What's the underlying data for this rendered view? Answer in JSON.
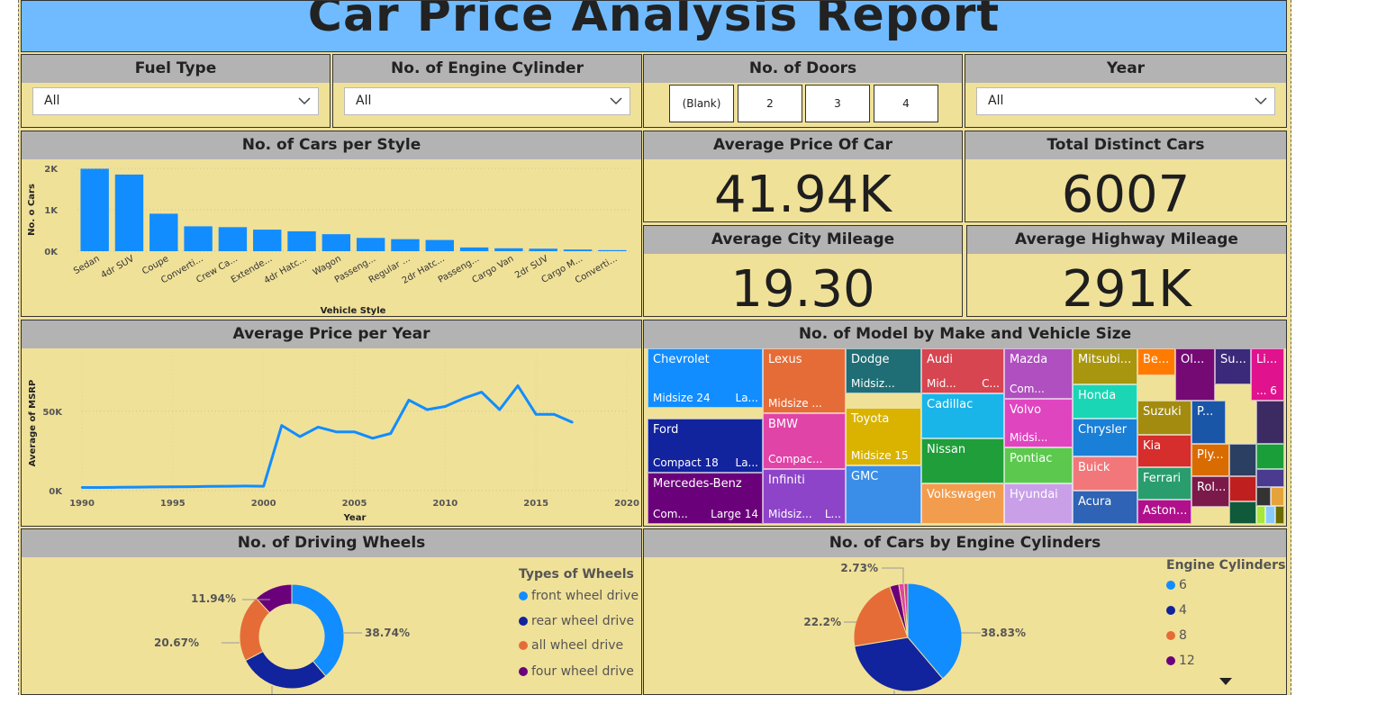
{
  "report_title": "Car Price Analysis Report",
  "filters": {
    "fuel_type": {
      "label": "Fuel Type",
      "value": "All"
    },
    "engine_cylinder": {
      "label": "No. of Engine Cylinder",
      "value": "All"
    },
    "doors": {
      "label": "No. of Doors",
      "options": [
        "(Blank)",
        "2",
        "3",
        "4"
      ]
    },
    "year": {
      "label": "Year",
      "value": "All"
    }
  },
  "kpis": {
    "avg_price": {
      "label": "Average Price Of Car",
      "value": "41.94K"
    },
    "total_cars": {
      "label": "Total Distinct Cars",
      "value": "6007"
    },
    "city_mileage": {
      "label": "Average City Mileage",
      "value": "19.30"
    },
    "highway_mileage": {
      "label": "Average Highway Mileage",
      "value": "291K"
    }
  },
  "colors": {
    "accent": "#118dff",
    "dark_blue": "#12239e",
    "orange": "#e66c37",
    "purple": "#6b007b",
    "panel_bg": "#f0e199",
    "header_bg": "#b3b3b3",
    "title_bg": "#70bbff"
  },
  "charts": {
    "style_chart": {
      "title": "No. of Cars per Style",
      "xlabel": "Vehicle Style",
      "ylabel": "No. o Cars",
      "ytick_labels": [
        "2K",
        "1K",
        "0K"
      ]
    },
    "year_chart": {
      "title": "Average Price per Year",
      "xlabel": "Year",
      "ylabel": "Average of MSRP",
      "ytick_labels": [
        "50K",
        "0K"
      ],
      "xtick_labels": [
        "1990",
        "1995",
        "2000",
        "2005",
        "2010",
        "2015",
        "2020"
      ]
    },
    "treemap": {
      "title": "No. of Model by Make and Vehicle Size"
    },
    "wheels_chart": {
      "title": "No. of Driving Wheels",
      "legend_title": "Types of Wheels"
    },
    "cylinders_chart": {
      "title": "No. of Cars by Engine Cylinders",
      "legend_title": "Engine Cylinders"
    }
  },
  "chart_data": [
    {
      "type": "bar",
      "title": "No. of Cars per Style",
      "xlabel": "Vehicle Style",
      "ylabel": "No. o Cars",
      "categories": [
        "Sedan",
        "4dr SUV",
        "Coupe",
        "Converti...",
        "Crew Ca...",
        "Extende...",
        "4dr Hatc...",
        "Wagon",
        "Passeng...",
        "Regular ...",
        "2dr Hatc...",
        "Passeng...",
        "Cargo Van",
        "2dr SUV",
        "Cargo M...",
        "Converti..."
      ],
      "values": [
        1990,
        1850,
        905,
        600,
        580,
        520,
        480,
        410,
        320,
        290,
        270,
        90,
        70,
        60,
        40,
        25
      ],
      "ylim": [
        0,
        2000
      ],
      "color": "#118dff"
    },
    {
      "type": "line",
      "title": "Average Price per Year",
      "xlabel": "Year",
      "ylabel": "Average of MSRP",
      "x": [
        1990,
        1991,
        1992,
        1993,
        1994,
        1995,
        1996,
        1997,
        1998,
        1999,
        2000,
        2001,
        2002,
        2003,
        2004,
        2005,
        2006,
        2007,
        2008,
        2009,
        2010,
        2011,
        2012,
        2013,
        2014,
        2015,
        2016,
        2017
      ],
      "y": [
        2000,
        2000,
        2100,
        2200,
        2300,
        2400,
        2500,
        2700,
        2800,
        2900,
        2800,
        41000,
        34000,
        40000,
        37000,
        37000,
        33000,
        36000,
        57000,
        51000,
        53000,
        58000,
        62000,
        51000,
        66000,
        48000,
        48000,
        43000
      ],
      "xlim": [
        1990,
        2020
      ],
      "ylim": [
        0,
        85000
      ],
      "color": "#118dff"
    },
    {
      "type": "pie",
      "title": "No. of Driving Wheels",
      "legend_title": "Types of Wheels",
      "donut": true,
      "series": [
        {
          "name": "front wheel drive",
          "value": 38.74,
          "label": "38.74%",
          "color": "#118dff"
        },
        {
          "name": "rear wheel drive",
          "value": 28.65,
          "label": "28.65%",
          "color": "#12239e"
        },
        {
          "name": "all wheel drive",
          "value": 20.67,
          "label": "20.67%",
          "color": "#e66c37"
        },
        {
          "name": "four wheel drive",
          "value": 11.94,
          "label": "11.94%",
          "color": "#6b007b"
        }
      ]
    },
    {
      "type": "pie",
      "title": "No. of Cars by Engine Cylinders",
      "legend_title": "Engine Cylinders",
      "donut": false,
      "series": [
        {
          "name": "6",
          "value": 38.83,
          "label": "38.83%",
          "color": "#118dff"
        },
        {
          "name": "4",
          "value": 33.53,
          "label": "33.53%",
          "color": "#12239e"
        },
        {
          "name": "8",
          "value": 22.2,
          "label": "22.2%",
          "color": "#e66c37"
        },
        {
          "name": "12",
          "value": 2.73,
          "label": "2.73%",
          "color": "#6b007b"
        },
        {
          "name": "",
          "value": 1.6,
          "label": "",
          "color": "#e044a7"
        },
        {
          "name": "",
          "value": 1.11,
          "label": "",
          "color": "#c83d95"
        }
      ]
    }
  ],
  "treemap_cells": [
    {
      "label": "Chevrolet",
      "sub": "Midsize 24",
      "sub2": "La...",
      "color": "#118dff"
    },
    {
      "label": "Lexus",
      "sub": "Midsize ...",
      "color": "#e66c37"
    },
    {
      "label": "Dodge",
      "sub": "Midsiz...",
      "color": "#1f6e75"
    },
    {
      "label": "Audi",
      "sub": "Mid...",
      "sub2": "C...",
      "color": "#d64550"
    },
    {
      "label": "Mazda",
      "sub": "Com...",
      "color": "#b04fc0"
    },
    {
      "label": "Mitsubi...",
      "color": "#a8960e"
    },
    {
      "label": "Be...",
      "color": "#ff7b00"
    },
    {
      "label": "Ol...",
      "color": "#750a75"
    },
    {
      "label": "Su...",
      "color": "#3b2a7a"
    },
    {
      "label": "Li...",
      "sub": "... 6",
      "color": "#e0128e"
    },
    {
      "label": "Honda",
      "color": "#1ad6b4"
    },
    {
      "label": "Suzuki",
      "color": "#a38b0f"
    },
    {
      "label": "P...",
      "color": "#1a56a8"
    },
    {
      "label": "Ford",
      "sub": "Compact 18",
      "sub2": "La...",
      "color": "#12239e"
    },
    {
      "label": "BMW",
      "sub": "Compac...",
      "color": "#e044a7"
    },
    {
      "label": "Toyota",
      "sub": "Midsize 15",
      "color": "#d9b300"
    },
    {
      "label": "Cadillac",
      "color": "#1ab5e8"
    },
    {
      "label": "Volvo",
      "sub": "Midsi...",
      "color": "#e045c0"
    },
    {
      "label": "Chrysler",
      "color": "#1a7fd6"
    },
    {
      "label": "Nissan",
      "color": "#1f9e3a"
    },
    {
      "label": "Pontiac",
      "color": "#5cc94e"
    },
    {
      "label": "Kia",
      "color": "#d62d2d"
    },
    {
      "label": "Ply...",
      "color": "#d96c00"
    },
    {
      "label": "Buick",
      "color": "#f2777a"
    },
    {
      "label": "Ferrari",
      "color": "#2a9d6e"
    },
    {
      "label": "Rol...",
      "color": "#7b1a4a"
    },
    {
      "label": "Mercedes-Benz",
      "sub": "Com...",
      "sub2": "Large 14",
      "color": "#6b007b"
    },
    {
      "label": "Infiniti",
      "sub": "Midsiz...",
      "sub2": "L...",
      "color": "#8e44c9"
    },
    {
      "label": "GMC",
      "color": "#3b8ee8"
    },
    {
      "label": "Volkswagen",
      "color": "#f29c4e"
    },
    {
      "label": "Hyundai",
      "color": "#c9a0e8"
    },
    {
      "label": "Acura",
      "color": "#2e63b5"
    },
    {
      "label": "Aston...",
      "color": "#b0108c"
    }
  ]
}
